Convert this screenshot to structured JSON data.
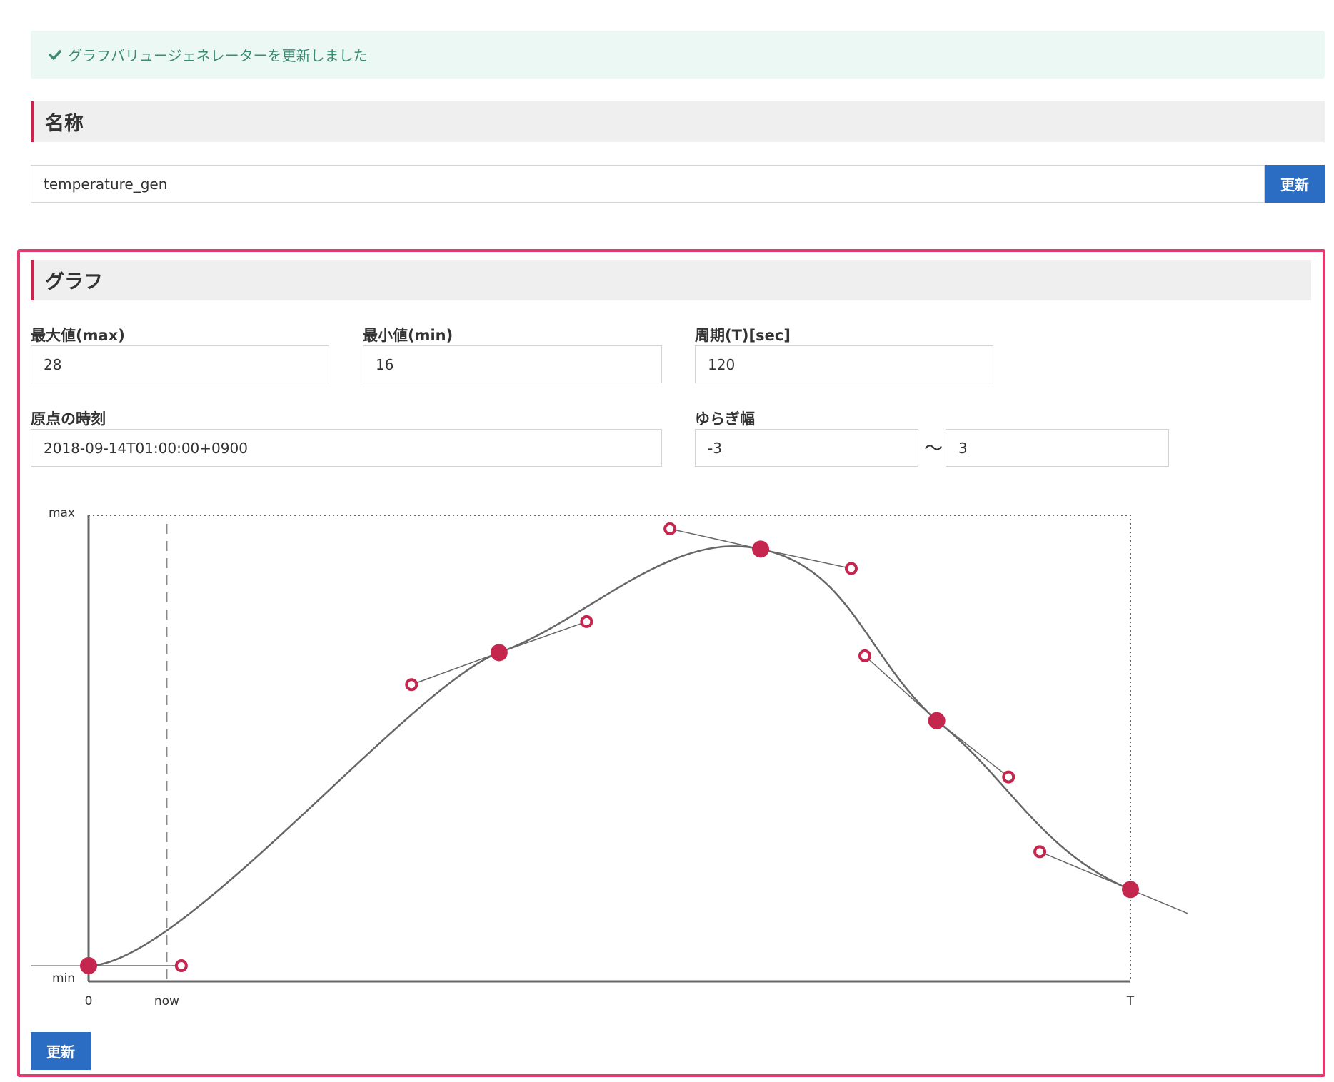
{
  "flash": {
    "message": "グラフバリュージェネレーターを更新しました",
    "icon": "check-icon",
    "color": "#3b8a73"
  },
  "name_section": {
    "title": "名称",
    "name_value": "temperature_gen",
    "update_label": "更新"
  },
  "graph_section": {
    "title": "グラフ",
    "max_label": "最大値(max)",
    "max_value": "28",
    "min_label": "最小値(min)",
    "min_value": "16",
    "period_label": "周期(T)[sec]",
    "period_value": "120",
    "origin_label": "原点の時刻",
    "origin_value": "2018-09-14T01:00:00+0900",
    "fluct_label": "ゆらぎ幅",
    "fluct_min": "-3",
    "fluct_sep": "〜",
    "fluct_max": "3",
    "update_label": "更新"
  },
  "colors": {
    "accent": "#c4264e",
    "panel_border": "#e6396f",
    "button": "#2a6dc2"
  },
  "chart_data": {
    "type": "line",
    "labels": {
      "y_top": "max",
      "y_bottom": "min",
      "x_start": "0",
      "x_now": "now",
      "x_end": "T"
    },
    "now_x": 0.075,
    "anchors": [
      {
        "x": 0.0,
        "y": 0.0
      },
      {
        "x": 0.394,
        "y": 0.695
      },
      {
        "x": 0.645,
        "y": 0.925
      },
      {
        "x": 0.814,
        "y": 0.544
      },
      {
        "x": 1.0,
        "y": 0.169
      }
    ],
    "handles": [
      {
        "anchor": 0,
        "x": 0.089,
        "y": 0.0
      },
      {
        "anchor": 1,
        "x": 0.31,
        "y": 0.624
      },
      {
        "anchor": 1,
        "x": 0.478,
        "y": 0.764
      },
      {
        "anchor": 2,
        "x": 0.558,
        "y": 0.97
      },
      {
        "anchor": 2,
        "x": 0.732,
        "y": 0.882
      },
      {
        "anchor": 3,
        "x": 0.745,
        "y": 0.688
      },
      {
        "anchor": 3,
        "x": 0.883,
        "y": 0.419
      },
      {
        "anchor": 4,
        "x": 0.913,
        "y": 0.253
      }
    ]
  }
}
